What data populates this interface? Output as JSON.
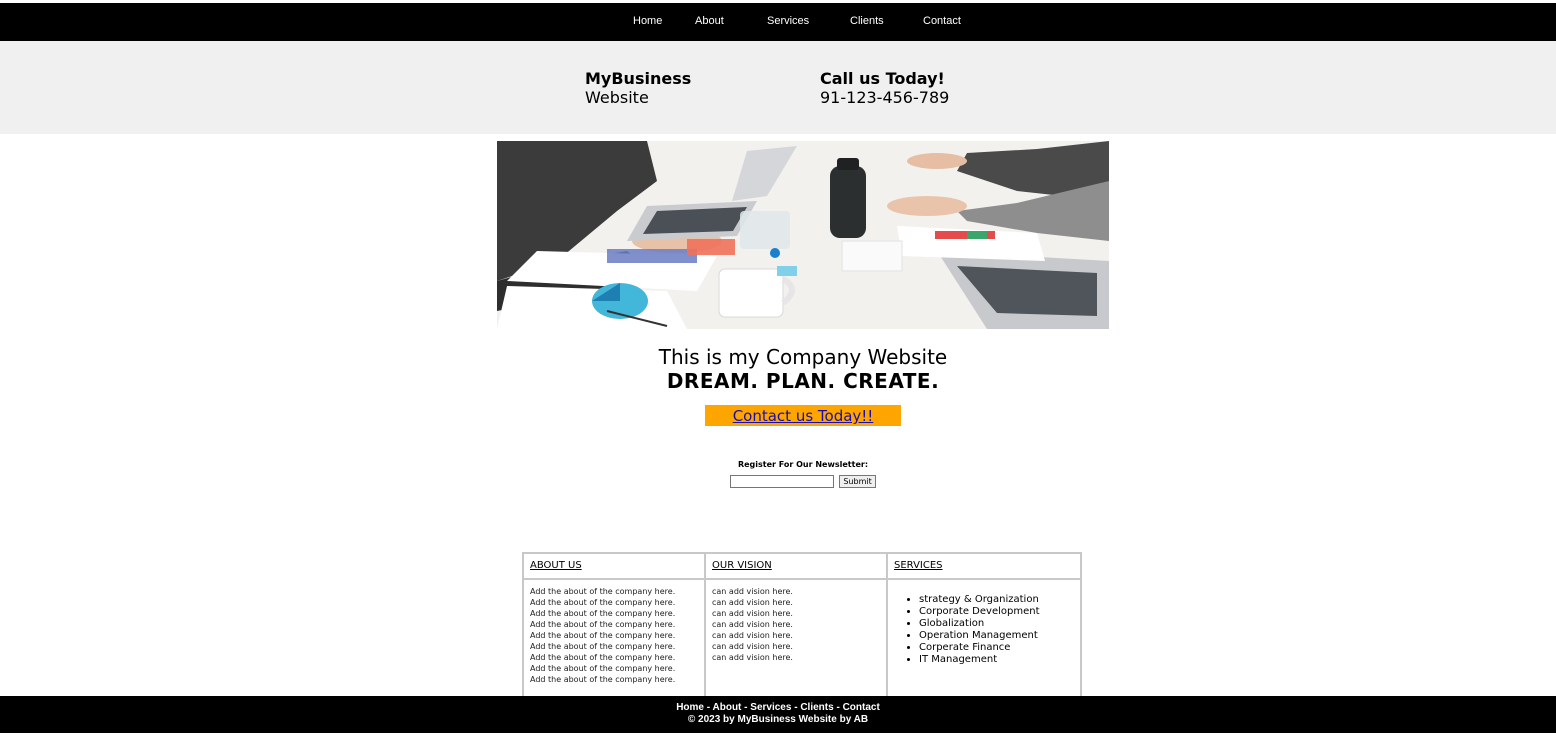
{
  "nav": {
    "items": [
      "Home",
      "About",
      "Services",
      "Clients",
      "Contact"
    ]
  },
  "header": {
    "brand_title": "MyBusiness",
    "brand_sub": "Website",
    "call_title": "Call us Today!",
    "call_number": "91-123-456-789"
  },
  "hero": {
    "line1": "This is my Company Website",
    "line2": "DREAM. PLAN. CREATE.",
    "cta_label": "Contact us Today!!"
  },
  "newsletter": {
    "label": "Register For Our Newsletter:",
    "input_value": "",
    "submit_label": "Submit"
  },
  "info": {
    "headers": [
      "ABOUT US",
      "OUR VISION",
      "SERVICES"
    ],
    "about_lines": [
      "Add the about of the company here.",
      "Add the about of the company here.",
      "Add the about of the company here.",
      "Add the about of the company here.",
      "Add the about of the company here.",
      "Add the about of the company here.",
      "Add the about of the company here.",
      "Add the about of the company here.",
      "Add the about of the company here."
    ],
    "vision_lines": [
      "can add vision here.",
      "can add vision here.",
      "can add vision here.",
      "can add vision here.",
      "can add vision here.",
      "can add vision here.",
      "can add vision here."
    ],
    "services": [
      "strategy & Organization",
      "Corporate Development",
      "Globalization",
      "Operation Management",
      "Corperate Finance",
      "IT Management"
    ]
  },
  "footer": {
    "links": [
      "Home",
      "About",
      "Services",
      "Clients",
      "Contact"
    ],
    "separator": " - ",
    "copyright": "© 2023 by MyBusiness Website by AB"
  },
  "colors": {
    "nav_bg": "#000000",
    "header_bg": "#f0f0f0",
    "cta_bg": "#ffa500",
    "link": "#1a0dab"
  }
}
